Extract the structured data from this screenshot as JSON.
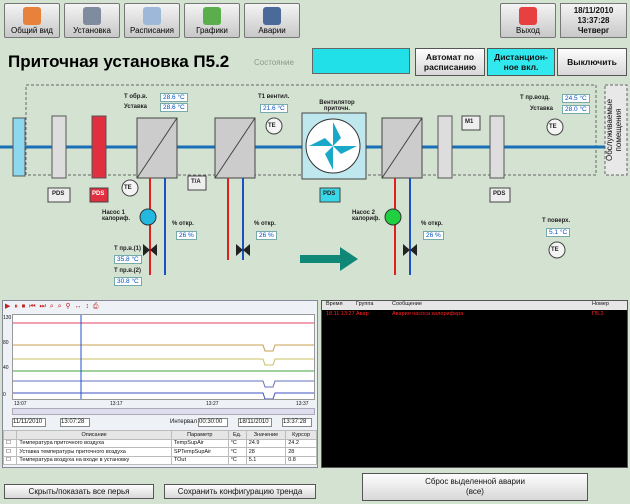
{
  "nav": [
    {
      "label": "Общий вид",
      "color": "#e8823a"
    },
    {
      "label": "Установка",
      "color": "#7f8ca0"
    },
    {
      "label": "Расписания",
      "color": "#9db8d8"
    },
    {
      "label": "Графики",
      "color": "#5aae4c"
    },
    {
      "label": "Аварии",
      "color": "#4a6a9a"
    }
  ],
  "exit_label": "Выход",
  "datetime": {
    "date": "18/11/2010",
    "time": "13:37:28",
    "day": "Четверг"
  },
  "title": "Приточная установка П5.2",
  "state_label": "Состояние",
  "state_color": "#22e0e8",
  "mode_buttons": [
    {
      "label": "Автомат по расписанию"
    },
    {
      "label": "Дистанцион-ное вкл."
    },
    {
      "label": "Выключить"
    }
  ],
  "served_room": "Обслуживаемые помещения",
  "labels": {
    "t_supply": "Т обр.в.",
    "setpoint1": "Уставка",
    "t_before_vent": "Т1 вентил.",
    "fan": "Вентилятор приточн.",
    "t_supply_air": "Т пр.возд.",
    "setpoint2": "Уставка",
    "pump1": "Насос 1 калориф.",
    "open1": "% откр.",
    "pump2": "Насос 2 калориф.",
    "open2": "% откр.",
    "t1_ret": "Т пр.в.(1)",
    "t2_ret": "Т пр.в.(2)",
    "t_room": "Т поверх.",
    "open_mid": "% откр.",
    "pds": "PDS",
    "pds2": "PDS",
    "pds3": "PDS",
    "pds4": "PDS",
    "mv": "М1",
    "ta": "Т/А",
    "te": "ТЕ",
    "te2": "ТЕ",
    "te3": "ТЕ",
    "te4": "ТЕ",
    "te5": "ТЕ"
  },
  "values": {
    "t_supply": "28.6 °C",
    "setpoint1": "28.6 °C",
    "t_before_vent": "21.6 °C",
    "t_supply_air": "24.5 °C",
    "setpoint2": "28.0 °C",
    "open1": "26 %",
    "open_mid": "26 %",
    "open2": "26 %",
    "t1_ret": "35.8 °C",
    "t2_ret": "30.8 °C",
    "t_room": "5.1 °C"
  },
  "trend": {
    "toolbar": "▶ ⏸ ⏹ ⏮ ⏭ ⌕ ⌕ ⚲ ↔ ↕ ⎙",
    "time_ticks": [
      "13:07",
      "13:17",
      "13:27",
      "13:37"
    ],
    "y_ticks": [
      "130",
      "120",
      "100",
      "80",
      "60",
      "40",
      "20",
      "10",
      "0"
    ],
    "date_start": "11/11/2010",
    "time_start": "13:07:28",
    "interval_label": "Интервал",
    "interval": "00:30:00",
    "date_end": "18/11/2010",
    "time_end": "13:37:28"
  },
  "table": {
    "headers": [
      "",
      "Описание",
      "Параметр",
      "Ед.",
      "Значение",
      "Курсор"
    ],
    "rows": [
      [
        "Температура приточного воздуха",
        "TempSupAir",
        "°C",
        "24.9",
        "24.2"
      ],
      [
        "Уставка температуры приточного воздуха",
        "SPTempSupAir",
        "°C",
        "28",
        "28"
      ],
      [
        "Температура воздуха на входе в установку",
        "TOut",
        "°C",
        "5.1",
        "0.8"
      ]
    ]
  },
  "alarm": {
    "headers": [
      "Время",
      "Группа",
      "Сообщение",
      "Номер"
    ],
    "row": [
      "18.11 13:27",
      "Авар",
      "Авария насоса калорифера",
      "П5.2"
    ]
  },
  "bottom_buttons": [
    "Скрыть/показать все перья",
    "Сохранить конфигурацию тренда"
  ],
  "reset_button": {
    "line1": "Сброс выделенной аварии",
    "line2": "(все)"
  }
}
